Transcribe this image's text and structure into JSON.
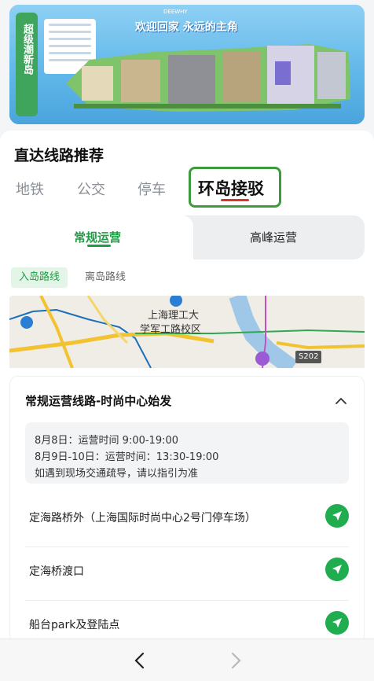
{
  "banner": {
    "headline": "欢迎回家 永远的主角",
    "vertical_text": "超级潮新岛",
    "brand": "DEEWHY"
  },
  "section": {
    "title": "直达线路推荐"
  },
  "mode_tabs": [
    {
      "label": "地铁",
      "active": false
    },
    {
      "label": "公交",
      "active": false
    },
    {
      "label": "停车",
      "active": false
    },
    {
      "label": "环岛接驳",
      "active": true
    }
  ],
  "operation_toggle": {
    "regular": "常规运营",
    "peak": "高峰运营",
    "selected": "常规运营"
  },
  "direction_chips": {
    "inbound": "入岛路线",
    "outbound": "离岛路线",
    "selected": "入岛路线"
  },
  "map": {
    "label_line1": "上海理工大",
    "label_line2": "学军工路校区",
    "road_badge": "S202"
  },
  "route": {
    "title": "常规运营线路-时尚中心始发",
    "notice": [
      "8月8日：运营时间 9:00-19:00",
      "8月9日-10日：运营时间：13:30-19:00",
      "如遇到现场交通疏导，请以指引为准"
    ],
    "stops": [
      "定海路桥外（上海国际时尚中心2号门停车场）",
      "定海桥渡口",
      "船台park及登陆点"
    ]
  },
  "colors": {
    "accent_green": "#1f9d45",
    "nav_green": "#1fad4f",
    "highlight_box": "#3c9c3c",
    "active_underline": "#d9352e"
  },
  "icons": {
    "collapse": "chevron-up-icon",
    "navigate": "navigation-arrow-icon",
    "back": "chevron-left-icon",
    "forward": "chevron-right-icon"
  }
}
